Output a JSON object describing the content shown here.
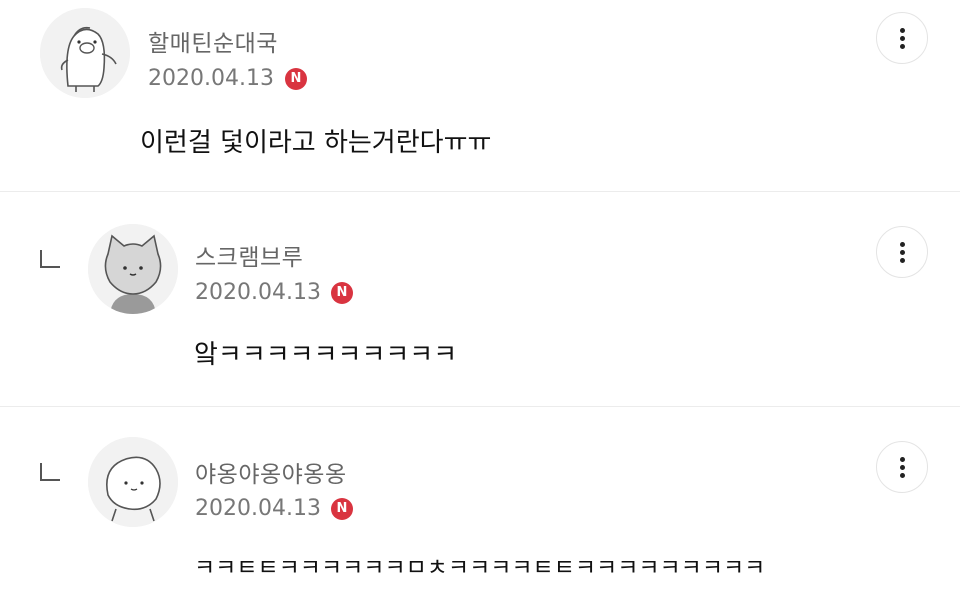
{
  "comments": [
    {
      "nickname": "할매틴순대국",
      "date": "2020.04.13",
      "badge": "N",
      "text": "이런걸 덫이라고 하는거란다ㅠㅠ",
      "avatar_icon": "penguin-character-icon",
      "is_reply": false
    },
    {
      "nickname": "스크램브루",
      "date": "2020.04.13",
      "badge": "N",
      "text": "앜ㅋㅋㅋㅋㅋㅋㅋㅋㅋㅋ",
      "avatar_icon": "cat-character-icon",
      "is_reply": true
    },
    {
      "nickname": "야옹야옹야옹옹",
      "date": "2020.04.13",
      "badge": "N",
      "text": "ㅋㅋㅌㅌㅋㅋㅋㅋㅋㅋㅁㅊㅋㅋㅋㅋㅌㅌㅋㅋㅋㅋㅋㅋㅋㅋㅋ",
      "avatar_icon": "blob-character-icon",
      "is_reply": true
    }
  ],
  "colors": {
    "badge": "#d93440",
    "nickname": "#666666",
    "divider": "#ececec"
  }
}
